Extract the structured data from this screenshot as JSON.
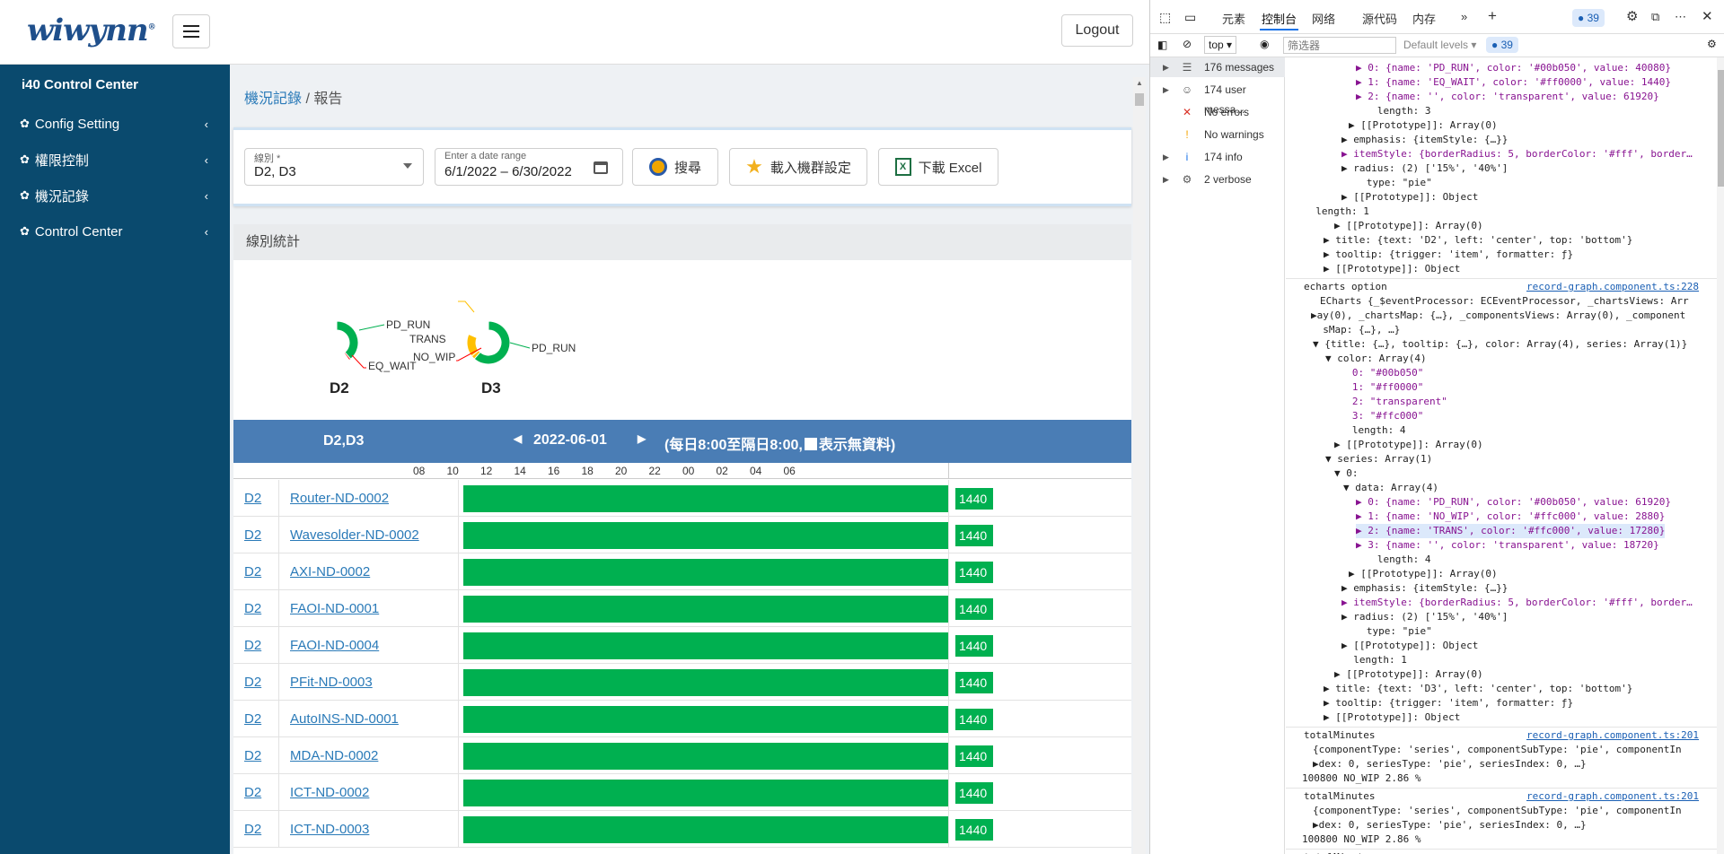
{
  "header": {
    "logo": "wiwynn",
    "logo_mark": "®",
    "logout": "Logout"
  },
  "sidebar": {
    "brand": "i40 Control Center",
    "items": [
      {
        "label": "Config Setting"
      },
      {
        "label": "權限控制"
      },
      {
        "label": "機況記錄"
      },
      {
        "label": "Control Center"
      }
    ]
  },
  "breadcrumb": {
    "parent": "機況記錄",
    "sep": "/",
    "current": "報告"
  },
  "filters": {
    "line_label": "線別 *",
    "line_value": "D2, D3",
    "date_label": "Enter a date range",
    "date_value": "6/1/2022 – 6/30/2022",
    "search_btn": "搜尋",
    "load_btn": "載入機群設定",
    "excel_btn": "下載 Excel"
  },
  "stats": {
    "header": "線別統計"
  },
  "chart_data": {
    "type": "pie",
    "colors": [
      "#00b050",
      "#ff0000",
      "transparent",
      "#ffc000"
    ],
    "charts": [
      {
        "title": "D2",
        "series": [
          {
            "name": "PD_RUN",
            "value": 40080
          },
          {
            "name": "EQ_WAIT",
            "value": 1440
          },
          {
            "name": "",
            "value": 61920
          }
        ]
      },
      {
        "title": "D3",
        "series": [
          {
            "name": "PD_RUN",
            "value": 61920
          },
          {
            "name": "NO_WIP",
            "value": 2880
          },
          {
            "name": "TRANS",
            "value": 17280
          },
          {
            "name": "",
            "value": 18720
          }
        ]
      }
    ]
  },
  "timeline": {
    "lines": "D2,D3",
    "prev": "◀",
    "date": "2022-06-01",
    "next": "▶",
    "note_pre": "(每日8:00至隔日8:00,",
    "note_post": "表示無資料)",
    "ticks": [
      "08",
      "10",
      "12",
      "14",
      "16",
      "18",
      "20",
      "22",
      "00",
      "02",
      "04",
      "06"
    ],
    "rows": [
      {
        "line": "D2",
        "machine": "Router-ND-0002",
        "total": "1440"
      },
      {
        "line": "D2",
        "machine": "Wavesolder-ND-0002",
        "total": "1440"
      },
      {
        "line": "D2",
        "machine": "AXI-ND-0002",
        "total": "1440"
      },
      {
        "line": "D2",
        "machine": "FAOI-ND-0001",
        "total": "1440"
      },
      {
        "line": "D2",
        "machine": "FAOI-ND-0004",
        "total": "1440"
      },
      {
        "line": "D2",
        "machine": "PFit-ND-0003",
        "total": "1440"
      },
      {
        "line": "D2",
        "machine": "AutoINS-ND-0001",
        "total": "1440"
      },
      {
        "line": "D2",
        "machine": "MDA-ND-0002",
        "total": "1440"
      },
      {
        "line": "D2",
        "machine": "ICT-ND-0002",
        "total": "1440"
      },
      {
        "line": "D2",
        "machine": "ICT-ND-0003",
        "total": "1440"
      }
    ]
  },
  "devtools": {
    "tabs": [
      "元素",
      "控制台",
      "网络",
      "源代码",
      "内存"
    ],
    "issues_count": "39",
    "context": "top",
    "filter_placeholder": "筛选器",
    "levels": "Default levels",
    "side": [
      {
        "label": "176 messages"
      },
      {
        "label": "174 user messa..."
      },
      {
        "label": "No errors"
      },
      {
        "label": "No warnings"
      },
      {
        "label": "174 info"
      },
      {
        "label": "2 verbose"
      }
    ],
    "lines": [
      "▶ 0: {name: 'PD_RUN', color: '#00b050', value: 40080}",
      "▶ 1: {name: 'EQ_WAIT', color: '#ff0000', value: 1440}",
      "▶ 2: {name: '', color: 'transparent', value: 61920}",
      "   length: 3",
      "▶ [[Prototype]]: Array(0)",
      "▶ emphasis: {itemStyle: {…}}",
      "▶ itemStyle: {borderRadius: 5, borderColor: '#fff', border…",
      "▶ radius: (2) ['15%', '40%']",
      "   type: \"pie\"",
      "▶ [[Prototype]]: Object",
      "  length: 1",
      "▶ [[Prototype]]: Array(0)",
      "▶ title: {text: 'D2', left: 'center', top: 'bottom'}",
      "▶ tooltip: {trigger: 'item', formatter: ƒ}",
      "▶ [[Prototype]]: Object",
      "echarts option",
      "ECharts {_$eventProcessor: ECEventProcessor, _chartsViews: Arr",
      "▶ay(0), _chartsMap: {…}, _componentsViews: Array(0), _component",
      "  sMap: {…}, …}",
      "▼ {title: {…}, tooltip: {…}, color: Array(4), series: Array(1)}",
      "▼ color: Array(4)",
      "   0: \"#00b050\"",
      "   1: \"#ff0000\"",
      "   2: \"transparent\"",
      "   3: \"#ffc000\"",
      "   length: 4",
      "▶ [[Prototype]]: Array(0)",
      "▼ series: Array(1)",
      "▼ 0:",
      "▼ data: Array(4)",
      "▶ 0: {name: 'PD_RUN', color: '#00b050', value: 61920}",
      "▶ 1: {name: 'NO_WIP', color: '#ffc000', value: 2880}",
      "▶ 2: {name: 'TRANS', color: '#ffc000', value: 17280}",
      "▶ 3: {name: '', color: 'transparent', value: 18720}",
      "   length: 4",
      "▶ [[Prototype]]: Array(0)",
      "▶ emphasis: {itemStyle: {…}}",
      "▶ itemStyle: {borderRadius: 5, borderColor: '#fff', border…",
      "▶ radius: (2) ['15%', '40%']",
      "   type: \"pie\"",
      "▶ [[Prototype]]: Object",
      "  length: 1",
      "▶ [[Prototype]]: Array(0)",
      "▶ title: {text: 'D3', left: 'center', top: 'bottom'}",
      "▶ tooltip: {trigger: 'item', formatter: ƒ}",
      "▶ [[Prototype]]: Object",
      "totalMinutes",
      "{componentType: 'series', componentSubType: 'pie', componentIn",
      "▶dex: 0, seriesType: 'pie', seriesIndex: 0, …}",
      "100800 NO_WIP 2.86 %",
      "totalMinutes",
      "{componentType: 'series', componentSubType: 'pie', componentIn",
      "▶dex: 0, seriesType: 'pie', seriesIndex: 0, …}",
      "100800 NO_WIP 2.86 %",
      "totalMinutes"
    ],
    "source_link": "record-graph.component.ts:228",
    "source_link2": "record-graph.component.ts:201"
  }
}
